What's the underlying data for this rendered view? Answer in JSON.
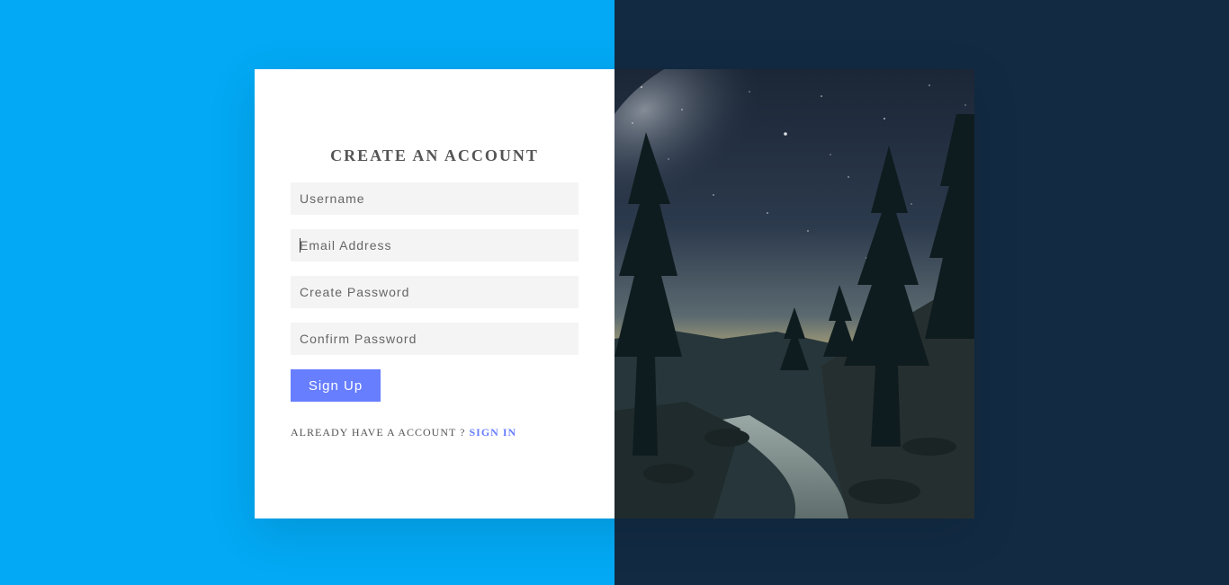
{
  "form": {
    "title": "CREATE AN ACCOUNT",
    "username_placeholder": "Username",
    "email_placeholder": "Email Address",
    "password_placeholder": "Create Password",
    "confirm_placeholder": "Confirm Password",
    "submit_label": "Sign Up",
    "signin_prompt": "ALREADY HAVE A ACCOUNT ?",
    "signin_link": "SIGN IN"
  },
  "colors": {
    "left_background": "#03a9f4",
    "right_background": "#122b43",
    "accent": "#677eff"
  }
}
